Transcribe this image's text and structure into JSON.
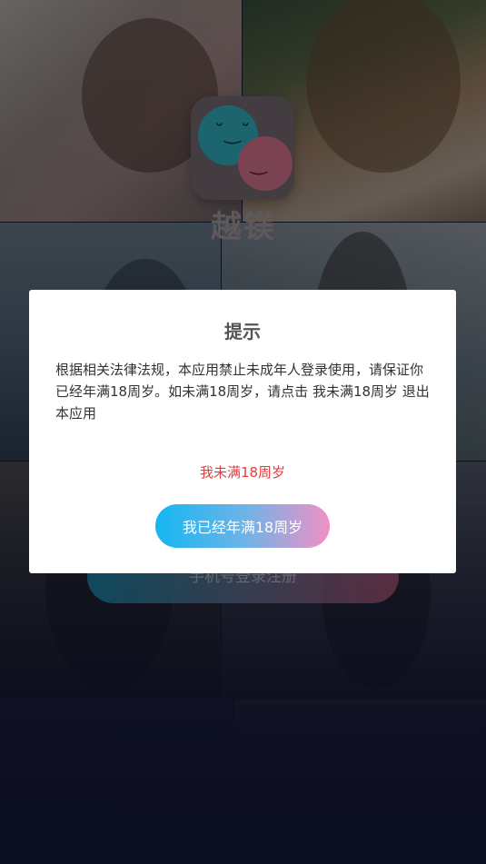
{
  "app": {
    "name": "越镁",
    "login_button_label": "手机号登录注册"
  },
  "dialog": {
    "title": "提示",
    "message": "根据相关法律法规，本应用禁止未成年人登录使用，请保证你已经年满18周岁。如未满18周岁，请点击 我未满18周岁 退出本应用",
    "underage_label": "我未满18周岁",
    "confirm_label": "我已经年满18周岁"
  },
  "colors": {
    "underage_text": "#e63a3a",
    "confirm_gradient_start": "#16b6f2",
    "confirm_gradient_end": "#f091c4"
  }
}
